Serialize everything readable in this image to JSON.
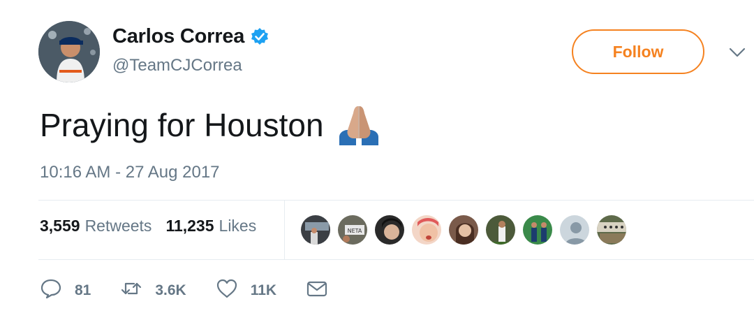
{
  "user": {
    "display_name": "Carlos Correa",
    "handle": "@TeamCJCorrea",
    "verified_icon": "verified-badge-icon",
    "avatar_icon": "avatar"
  },
  "header": {
    "follow_label": "Follow",
    "menu_icon": "chevron-down-icon"
  },
  "tweet": {
    "text": "Praying for Houston",
    "emoji_icon": "folded-hands-icon",
    "timestamp": "10:16 AM - 27 Aug 2017"
  },
  "stats": {
    "retweets_count": "3,559",
    "retweets_label": "Retweets",
    "likes_count": "11,235",
    "likes_label": "Likes"
  },
  "likers": [
    "liker-avatar-1",
    "liker-avatar-2",
    "liker-avatar-3",
    "liker-avatar-4",
    "liker-avatar-5",
    "liker-avatar-6",
    "liker-avatar-7",
    "liker-avatar-8",
    "liker-avatar-9"
  ],
  "actions": {
    "reply_count": "81",
    "retweet_count": "3.6K",
    "like_count": "11K"
  },
  "colors": {
    "accent": "#f58220",
    "verified": "#1da1f2",
    "muted": "#657786",
    "text": "#14171a"
  }
}
